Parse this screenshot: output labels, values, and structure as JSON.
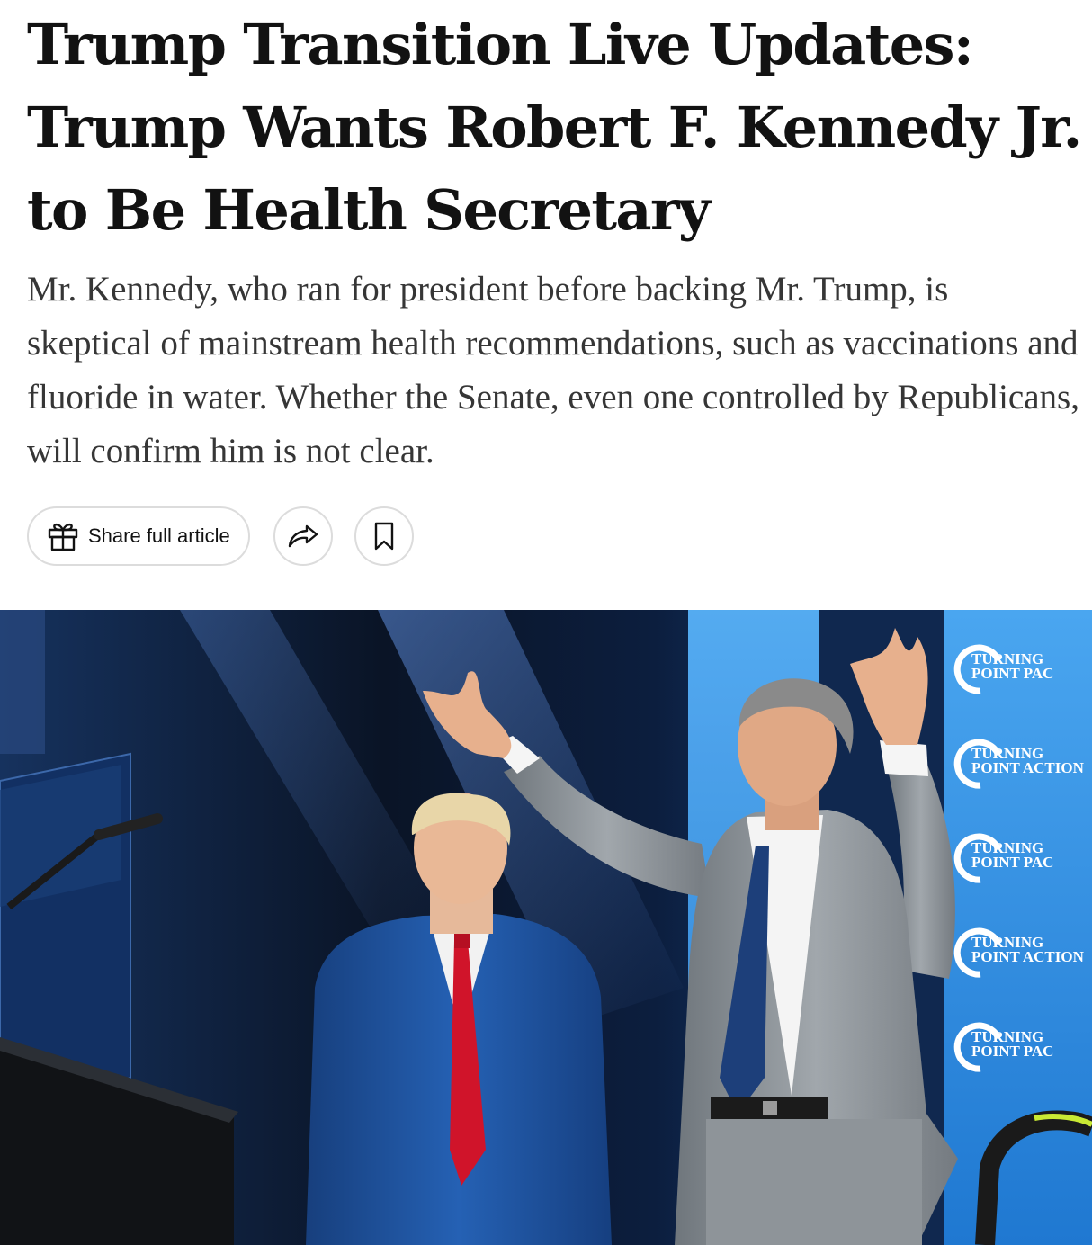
{
  "article": {
    "headline": "Trump Transition Live Updates: Trump Wants Robert F. Kennedy Jr. to Be Health Secretary",
    "summary": "Mr. Kennedy, who ran for president before backing Mr. Trump, is skeptical of mainstream health recommendations, such as vaccinations and fluoride in water. Whether the Senate, even one controlled by Republicans, will confirm him is not clear."
  },
  "actions": {
    "share_full_article_label": "Share full article",
    "gift_icon": "gift-icon",
    "share_icon": "share-arrow-icon",
    "bookmark_icon": "bookmark-icon"
  },
  "photo": {
    "banner_lines": [
      [
        "TURNING",
        "POINT PAC"
      ],
      [
        "TURNING",
        "POINT ACTION"
      ],
      [
        "TURNING",
        "POINT PAC"
      ],
      [
        "TURNING",
        "POINT ACTION"
      ],
      [
        "TURNING",
        "POINT PAC"
      ]
    ],
    "colors": {
      "backdrop": "#0b1a33",
      "banner": "#2f8fe0",
      "left_suit": "#1f5aa8",
      "left_tie": "#d0142a",
      "right_suit": "#8e9499"
    }
  }
}
